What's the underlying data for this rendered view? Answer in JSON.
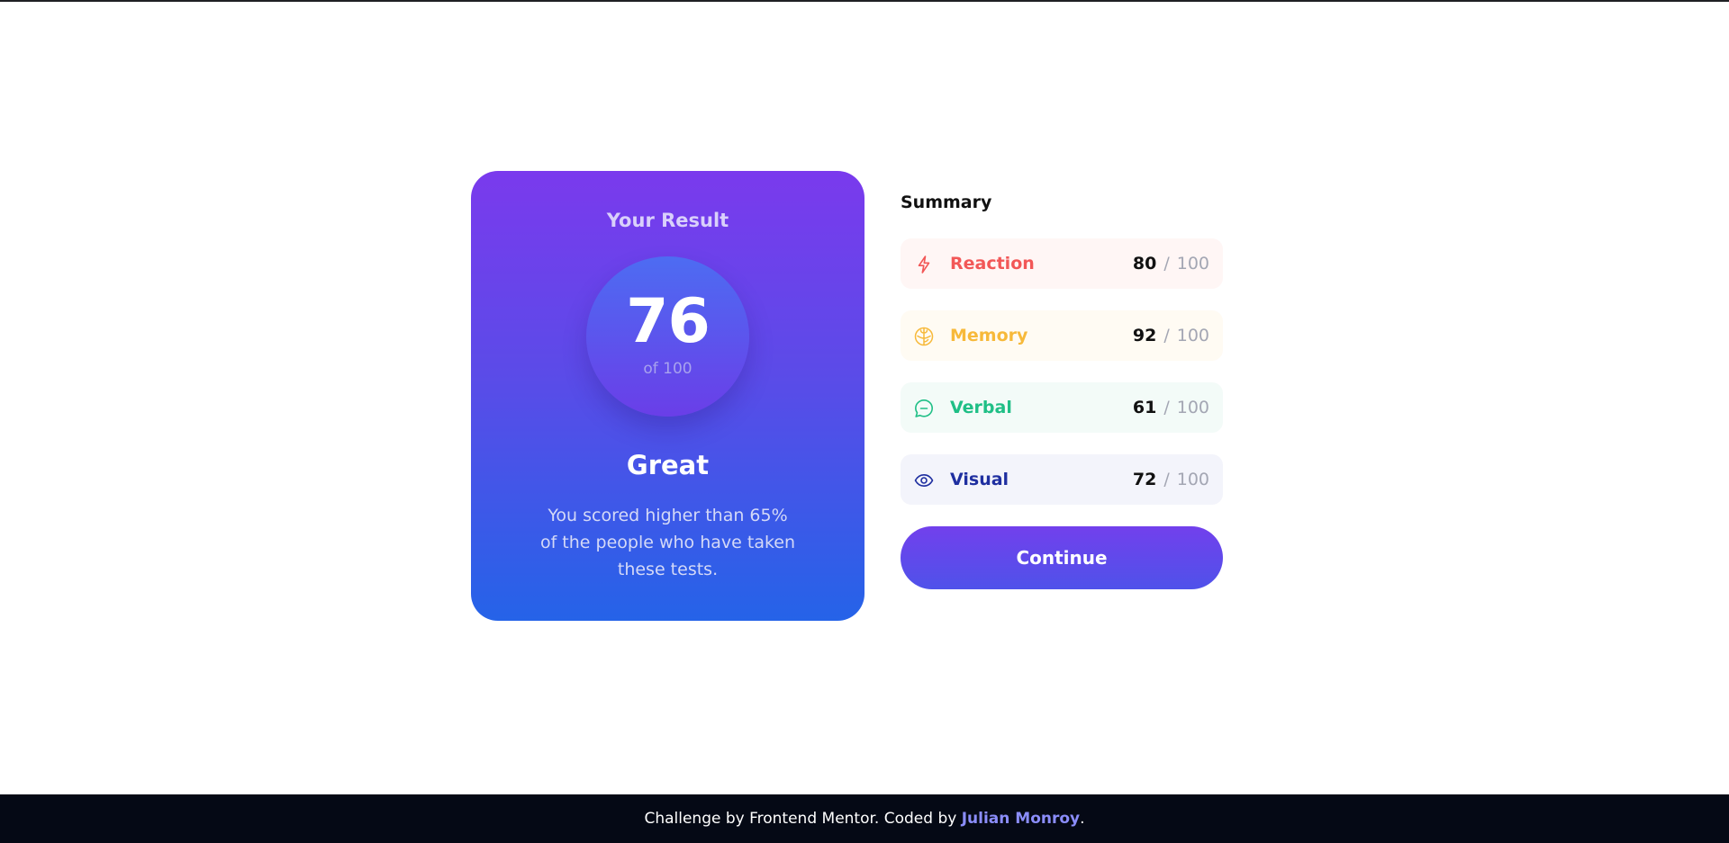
{
  "result": {
    "heading": "Your Result",
    "score": "76",
    "score_max": "of 100",
    "rating": "Great",
    "description": "You scored higher than 65% of the people who have taken these tests."
  },
  "summary": {
    "heading": "Summary",
    "items": [
      {
        "label": "Reaction",
        "score": "80",
        "separator": "/",
        "max": "100",
        "icon": "lightning-icon",
        "color": "#f25757",
        "bg": "#fff6f5"
      },
      {
        "label": "Memory",
        "score": "92",
        "separator": "/",
        "max": "100",
        "icon": "brain-icon",
        "color": "#f7b93a",
        "bg": "#fffbf3"
      },
      {
        "label": "Verbal",
        "score": "61",
        "separator": "/",
        "max": "100",
        "icon": "chat-bubble-icon",
        "color": "#1fbf86",
        "bg": "#f3fbf8"
      },
      {
        "label": "Visual",
        "score": "72",
        "separator": "/",
        "max": "100",
        "icon": "eye-icon",
        "color": "#1f2fa0",
        "bg": "#f3f4fb"
      }
    ],
    "continue_label": "Continue"
  },
  "footer": {
    "prefix": "Challenge by Frontend Mentor. Coded by ",
    "author": "Julian Monroy",
    "suffix": "."
  },
  "colors": {
    "accent_top": "#7a3aed",
    "accent_bottom": "#2563e8",
    "footer_bg": "#050915",
    "link": "#8b8dfa"
  }
}
